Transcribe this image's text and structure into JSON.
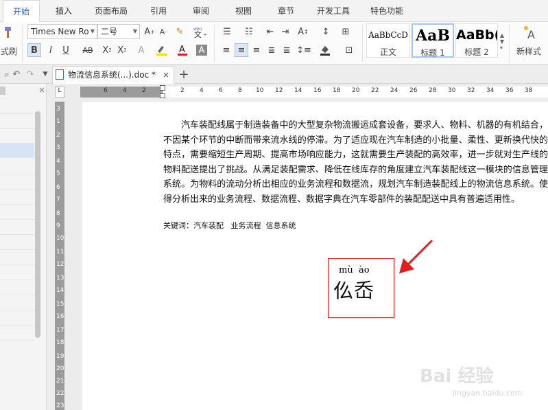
{
  "menu": {
    "tabs": [
      {
        "label": "开始",
        "active": true
      },
      {
        "label": "插入"
      },
      {
        "label": "页面布局"
      },
      {
        "label": "引用"
      },
      {
        "label": "审阅"
      },
      {
        "label": "视图"
      },
      {
        "label": "章节"
      },
      {
        "label": "开发工具"
      },
      {
        "label": "特色功能"
      }
    ]
  },
  "ribbon": {
    "format_painter_label": "式刷",
    "font_name": "Times New Ro",
    "font_size": "二号",
    "styles": [
      {
        "sample": "AaBbCcD",
        "label": "正文"
      },
      {
        "sample": "AaB",
        "label": "标题 1"
      },
      {
        "sample": "AaBb(",
        "label": "标题 2"
      }
    ],
    "new_style_label": "新样式"
  },
  "document_tab": {
    "title": "物流信息系统(...).doc *",
    "close": "×",
    "add": "+"
  },
  "ruler": {
    "horizontal": [
      "6",
      "4",
      "2",
      "2",
      "4",
      "6",
      "8",
      "10",
      "12",
      "14",
      "16",
      "18",
      "20",
      "22",
      "24",
      "26",
      "28",
      "30",
      "32",
      "34",
      "36",
      "38"
    ],
    "vertical": [
      "3",
      "1",
      "2",
      "3",
      "4",
      "5",
      "6",
      "7",
      "8",
      "9",
      "10",
      "11",
      "12",
      "13",
      "14",
      "15",
      "16",
      "17",
      "18",
      "19",
      "20",
      "21",
      "22",
      "23"
    ]
  },
  "document": {
    "paragraph": "汽车装配线属于制造装备中的大型复杂物流搬运成套设备，要求人、物料、机器的有机结合，不因某个环节的中断而带来流水线的停滞。为了适应现在汽车制造的小批量、柔性、更新换代快的特点，需要缩短生产周期、提高市场响应能力，这就需要生产装配的高效率，进一步就对生产线的物料配送提出了挑战。从满足装配需求、降低在线库存的角度建立汽车装配线这一模块的信息管理系统。为物料的流动分析出相应的业务流程和数据流，规划汽车制造装配线上的物流信息系统。使得分析出来的业务流程、数据流程、数据字典在汽车零部件的装配配送中具有普遍适用性。",
    "keywords": "关键词：汽车装配   业务流程  信息系统",
    "pinyin": "mù  ào",
    "characters": "仫岙"
  },
  "colors": {
    "accent": "#2a62c9",
    "highlight_box": "#e02020",
    "arrow": "#e02020"
  },
  "watermark": {
    "main": "Bai 经验",
    "sub": "jingyan.baidu.com"
  }
}
